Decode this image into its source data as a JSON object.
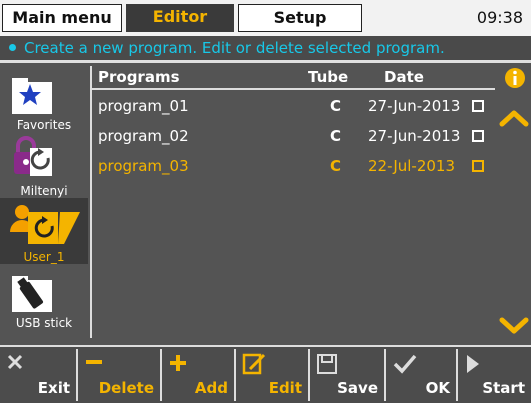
{
  "tabs": {
    "main_menu": "Main menu",
    "editor": "Editor",
    "setup": "Setup"
  },
  "clock": "09:38",
  "info_text": "Create a new program. Edit or delete selected program.",
  "sidebar": {
    "items": [
      {
        "label": "Favorites",
        "icon": "star-folder-icon"
      },
      {
        "label": "Miltenyi",
        "icon": "lock-refresh-icon"
      },
      {
        "label": "User_1",
        "icon": "user-refresh-icon",
        "active": true
      },
      {
        "label": "USB stick",
        "icon": "usb-folder-icon"
      }
    ]
  },
  "table": {
    "headers": {
      "programs": "Programs",
      "tube": "Tube",
      "date": "Date"
    },
    "rows": [
      {
        "name": "program_01",
        "tube": "C",
        "date": "27-Jun-2013",
        "selected": false
      },
      {
        "name": "program_02",
        "tube": "C",
        "date": "27-Jun-2013",
        "selected": false
      },
      {
        "name": "program_03",
        "tube": "C",
        "date": "22-Jul-2013",
        "selected": true
      }
    ]
  },
  "toolbar": {
    "exit": "Exit",
    "delete": "Delete",
    "add": "Add",
    "edit": "Edit",
    "save": "Save",
    "ok": "OK",
    "start": "Start"
  },
  "colors": {
    "accent": "#f4b400",
    "info": "#18c8e8",
    "background": "#545454"
  }
}
